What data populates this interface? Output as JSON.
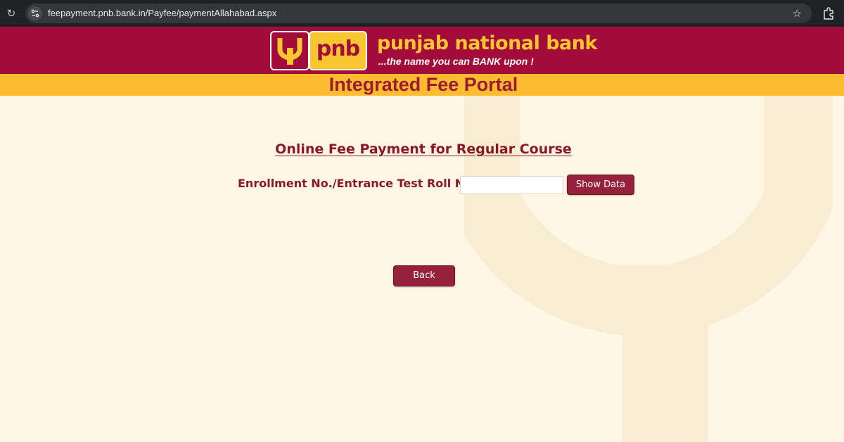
{
  "browser": {
    "url": "feepayment.pnb.bank.in/Payfee/paymentAllahabad.aspx",
    "icons": [
      "reload-icon",
      "site-info-icon",
      "star-icon",
      "extensions-icon"
    ]
  },
  "header": {
    "logo_text": "pnb",
    "bank_name": "punjab national bank",
    "tagline": "...the name you can BANK upon !",
    "colors": {
      "maroon": "#a20b3a",
      "gold": "#f9c531"
    }
  },
  "portal": {
    "title": "Integrated Fee Portal",
    "strip_color": "#fdbb30"
  },
  "main": {
    "heading": "Online Fee Payment for Regular Course",
    "enrollment_label": "Enrollment No./Entrance Test Roll No:",
    "enrollment_value": "",
    "show_data_label": "Show Data",
    "back_label": "Back",
    "button_color": "#95213b"
  }
}
